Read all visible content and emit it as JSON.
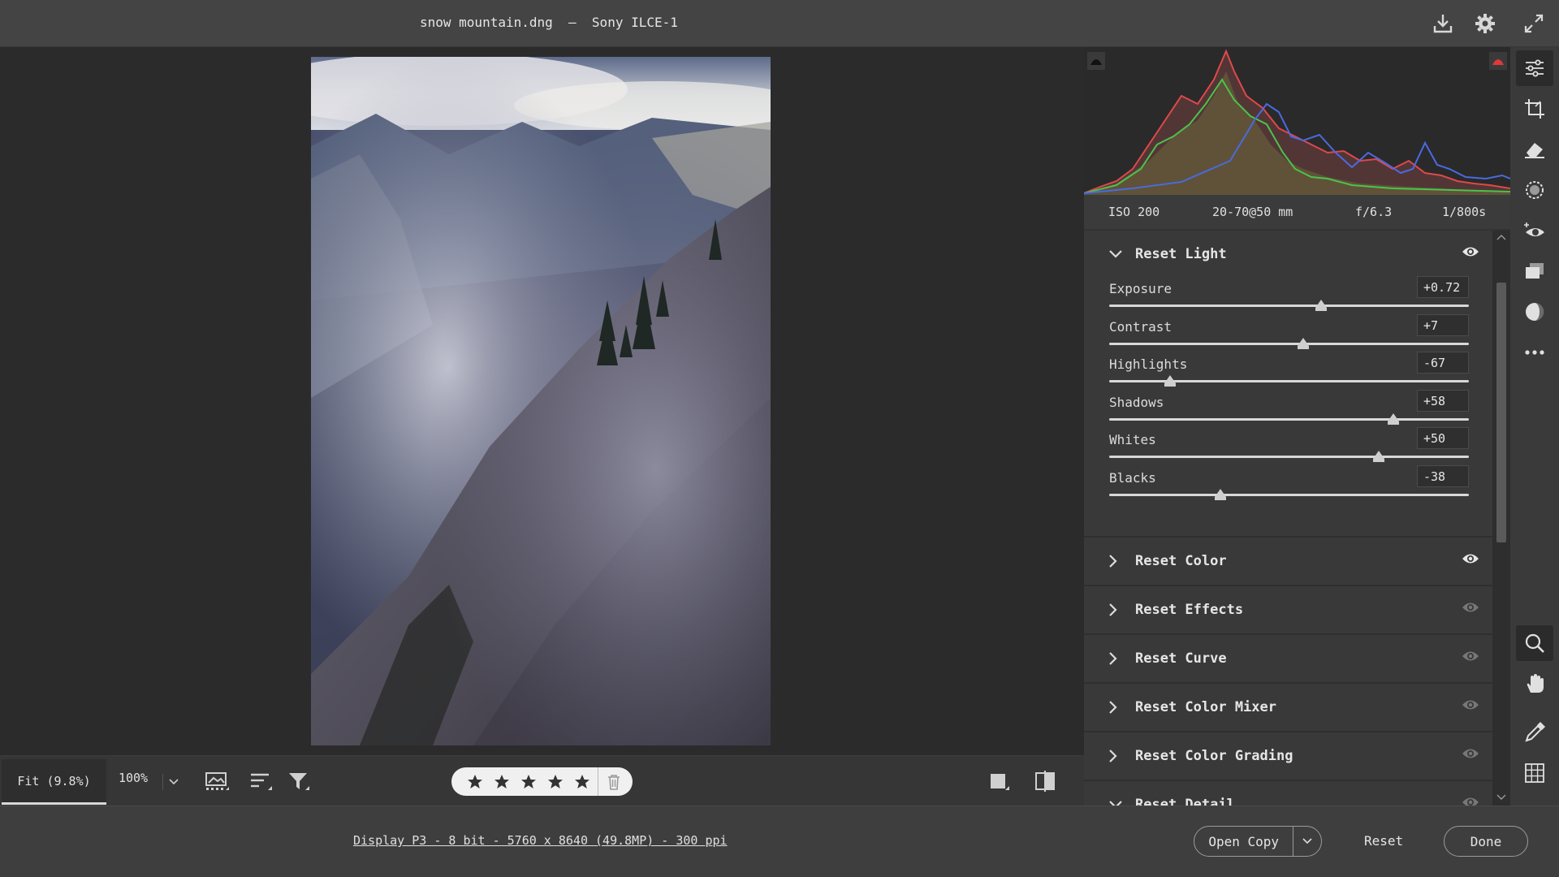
{
  "window": {
    "title": "snow mountain.dng  –  Sony ILCE-1"
  },
  "title_icons": [
    "save-download-icon",
    "gear-icon",
    "fullscreen-icon"
  ],
  "exif": {
    "iso": "ISO 200",
    "lens": "20-70@50 mm",
    "aperture": "f/6.3",
    "shutter": "1/800s"
  },
  "light": {
    "title": "Reset Light",
    "sliders": [
      {
        "label": "Exposure",
        "value": "+0.72",
        "level": 0.59
      },
      {
        "label": "Contrast",
        "value": "+7",
        "level": 0.54
      },
      {
        "label": "Highlights",
        "value": "-67",
        "level": 0.17
      },
      {
        "label": "Shadows",
        "value": "+58",
        "level": 0.79
      },
      {
        "label": "Whites",
        "value": "+50",
        "level": 0.75
      },
      {
        "label": "Blacks",
        "value": "-38",
        "level": 0.31
      }
    ]
  },
  "sections": [
    {
      "title": "Reset Color",
      "visible": true
    },
    {
      "title": "Reset Effects",
      "visible": false
    },
    {
      "title": "Reset Curve",
      "visible": false
    },
    {
      "title": "Reset Color Mixer",
      "visible": false
    },
    {
      "title": "Reset Color Grading",
      "visible": false
    },
    {
      "title": "Reset Detail",
      "visible": false
    }
  ],
  "viewbar": {
    "zoom_fit": "Fit (9.8%)",
    "zoom_100": "100%",
    "rating_stars": 5
  },
  "status": {
    "display_info": "Display P3 - 8 bit - 5760 x 8640 (49.8MP) - 300 ppi",
    "open_copy": "Open Copy",
    "reset": "Reset",
    "done": "Done"
  },
  "colors": {
    "accent_clip_warning": "#e0383b",
    "panel_bg": "#393939"
  }
}
